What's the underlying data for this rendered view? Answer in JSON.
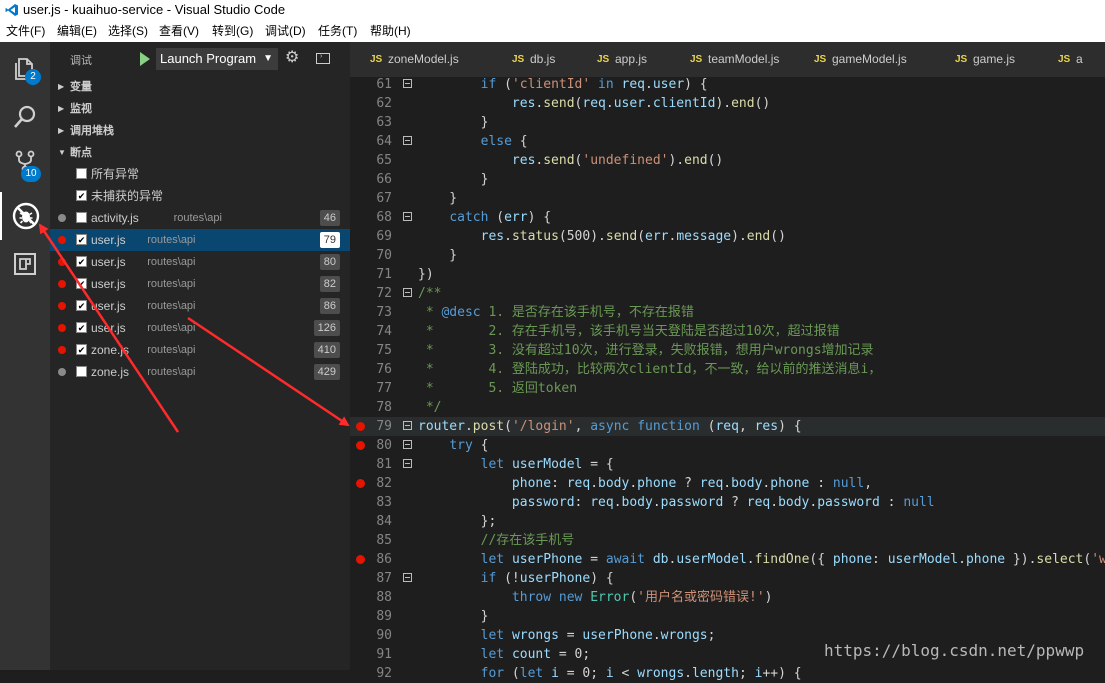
{
  "window": {
    "title": "user.js - kuaihuo-service - Visual Studio Code"
  },
  "menu": [
    "文件(F)",
    "编辑(E)",
    "选择(S)",
    "查看(V)",
    "转到(G)",
    "调试(D)",
    "任务(T)",
    "帮助(H)"
  ],
  "activity": {
    "explorer_badge": "2",
    "scm_badge": "10"
  },
  "debug": {
    "title": "调试",
    "config": "Launch Program"
  },
  "sections": {
    "variables": "变量",
    "watch": "监视",
    "callstack": "调用堆栈",
    "breakpoints": "断点"
  },
  "exceptions": [
    {
      "label": "所有异常",
      "checked": false
    },
    {
      "label": "未捕获的异常",
      "checked": true
    }
  ],
  "breakpoints": [
    {
      "file": "activity.js",
      "path": "routes\\api",
      "line": "46",
      "checked": false,
      "active": false,
      "selected": false
    },
    {
      "file": "user.js",
      "path": "routes\\api",
      "line": "79",
      "checked": true,
      "active": true,
      "selected": true
    },
    {
      "file": "user.js",
      "path": "routes\\api",
      "line": "80",
      "checked": true,
      "active": true,
      "selected": false
    },
    {
      "file": "user.js",
      "path": "routes\\api",
      "line": "82",
      "checked": true,
      "active": true,
      "selected": false
    },
    {
      "file": "user.js",
      "path": "routes\\api",
      "line": "86",
      "checked": true,
      "active": true,
      "selected": false
    },
    {
      "file": "user.js",
      "path": "routes\\api",
      "line": "126",
      "checked": true,
      "active": true,
      "selected": false
    },
    {
      "file": "zone.js",
      "path": "routes\\api",
      "line": "410",
      "checked": true,
      "active": true,
      "selected": false
    },
    {
      "file": "zone.js",
      "path": "routes\\api",
      "line": "429",
      "checked": false,
      "active": false,
      "selected": false
    }
  ],
  "tabs": [
    {
      "icon": "JS",
      "name": "zoneModel.js"
    },
    {
      "icon": "JS",
      "name": "db.js"
    },
    {
      "icon": "JS",
      "name": "app.js"
    },
    {
      "icon": "JS",
      "name": "teamModel.js"
    },
    {
      "icon": "JS",
      "name": "gameModel.js"
    },
    {
      "icon": "JS",
      "name": "game.js"
    },
    {
      "icon": "JS",
      "name": "a"
    }
  ],
  "code_lines": [
    {
      "n": "61",
      "bp": false,
      "fold": true,
      "html": "        <span class='k'>if</span> (<span class='s'>'clientId'</span> <span class='k'>in</span> <span class='v'>req</span>.<span class='v'>user</span>) {"
    },
    {
      "n": "62",
      "bp": false,
      "fold": false,
      "html": "            <span class='v'>res</span>.<span class='f'>send</span>(<span class='v'>req</span>.<span class='v'>user</span>.<span class='v'>clientId</span>).<span class='f'>end</span>()"
    },
    {
      "n": "63",
      "bp": false,
      "fold": false,
      "html": "        }"
    },
    {
      "n": "64",
      "bp": false,
      "fold": true,
      "html": "        <span class='k'>else</span> {"
    },
    {
      "n": "65",
      "bp": false,
      "fold": false,
      "html": "            <span class='v'>res</span>.<span class='f'>send</span>(<span class='s'>'undefined'</span>).<span class='f'>end</span>()"
    },
    {
      "n": "66",
      "bp": false,
      "fold": false,
      "html": "        }"
    },
    {
      "n": "67",
      "bp": false,
      "fold": false,
      "html": "    }"
    },
    {
      "n": "68",
      "bp": false,
      "fold": true,
      "html": "    <span class='k'>catch</span> (<span class='v'>err</span>) {"
    },
    {
      "n": "69",
      "bp": false,
      "fold": false,
      "html": "        <span class='v'>res</span>.<span class='f'>status</span>(500).<span class='f'>send</span>(<span class='v'>err</span>.<span class='v'>message</span>).<span class='f'>end</span>()"
    },
    {
      "n": "70",
      "bp": false,
      "fold": false,
      "html": "    }"
    },
    {
      "n": "71",
      "bp": false,
      "fold": false,
      "html": "})"
    },
    {
      "n": "72",
      "bp": false,
      "fold": true,
      "html": "<span class='c'>/**</span>"
    },
    {
      "n": "73",
      "bp": false,
      "fold": false,
      "html": "<span class='c'> * </span><span class='k'>@desc</span><span class='c'> 1. 是否存在该手机号，不存在报错</span>"
    },
    {
      "n": "74",
      "bp": false,
      "fold": false,
      "html": "<span class='c'> *       2. 存在手机号，该手机号当天登陆是否超过10次，超过报错</span>"
    },
    {
      "n": "75",
      "bp": false,
      "fold": false,
      "html": "<span class='c'> *       3. 没有超过10次，进行登录，失败报错，想用户wrongs增加记录</span>"
    },
    {
      "n": "76",
      "bp": false,
      "fold": false,
      "html": "<span class='c'> *       4. 登陆成功，比较两次clientId，不一致，给以前的推送消息i，</span>"
    },
    {
      "n": "77",
      "bp": false,
      "fold": false,
      "html": "<span class='c'> *       5. 返回token</span>"
    },
    {
      "n": "78",
      "bp": false,
      "fold": false,
      "html": "<span class='c'> */</span>"
    },
    {
      "n": "79",
      "bp": true,
      "fold": true,
      "hl": true,
      "html": "<span class='v'>router</span>.<span class='f'>post</span>(<span class='s'>'/login'</span>, <span class='k'>async</span> <span class='k'>function</span> (<span class='v'>req</span>, <span class='v'>res</span>) {"
    },
    {
      "n": "80",
      "bp": true,
      "fold": true,
      "html": "    <span class='k'>try</span> {"
    },
    {
      "n": "81",
      "bp": false,
      "fold": true,
      "html": "        <span class='k'>let</span> <span class='v'>userModel</span> = {"
    },
    {
      "n": "82",
      "bp": true,
      "fold": false,
      "html": "            <span class='v'>phone</span>: <span class='v'>req</span>.<span class='v'>body</span>.<span class='v'>phone</span> ? <span class='v'>req</span>.<span class='v'>body</span>.<span class='v'>phone</span> : <span class='k'>null</span>,"
    },
    {
      "n": "83",
      "bp": false,
      "fold": false,
      "html": "            <span class='v'>password</span>: <span class='v'>req</span>.<span class='v'>body</span>.<span class='v'>password</span> ? <span class='v'>req</span>.<span class='v'>body</span>.<span class='v'>password</span> : <span class='k'>null</span>"
    },
    {
      "n": "84",
      "bp": false,
      "fold": false,
      "html": "        };"
    },
    {
      "n": "85",
      "bp": false,
      "fold": false,
      "html": "        <span class='c'>//存在该手机号</span>"
    },
    {
      "n": "86",
      "bp": true,
      "fold": false,
      "html": "        <span class='k'>let</span> <span class='v'>userPhone</span> = <span class='k'>await</span> <span class='v'>db</span>.<span class='v'>userModel</span>.<span class='f'>findOne</span>({ <span class='v'>phone</span>: <span class='v'>userModel</span>.<span class='v'>phone</span> }).<span class='f'>select</span>(<span class='s'>'wrc</span>"
    },
    {
      "n": "87",
      "bp": false,
      "fold": true,
      "html": "        <span class='k'>if</span> (!<span class='v'>userPhone</span>) {"
    },
    {
      "n": "88",
      "bp": false,
      "fold": false,
      "html": "            <span class='k'>throw</span> <span class='k'>new</span> <span class='fn'>Error</span>(<span class='s'>'用户名或密码错误!'</span>)"
    },
    {
      "n": "89",
      "bp": false,
      "fold": false,
      "html": "        }"
    },
    {
      "n": "90",
      "bp": false,
      "fold": false,
      "html": "        <span class='k'>let</span> <span class='v'>wrongs</span> = <span class='v'>userPhone</span>.<span class='v'>wrongs</span>;"
    },
    {
      "n": "91",
      "bp": false,
      "fold": false,
      "html": "        <span class='k'>let</span> <span class='v'>count</span> = 0;"
    },
    {
      "n": "92",
      "bp": false,
      "fold": false,
      "html": "        <span class='k'>for</span> (<span class='k'>let</span> <span class='v'>i</span> = 0; <span class='v'>i</span> &lt; <span class='v'>wrongs</span>.<span class='v'>length</span>; <span class='v'>i</span>++) {"
    }
  ],
  "watermark": "https://blog.csdn.net/ppwwp",
  "colors": {
    "accent": "#007acc",
    "breakpoint": "#e51400",
    "arrow": "#ff2b2b"
  }
}
